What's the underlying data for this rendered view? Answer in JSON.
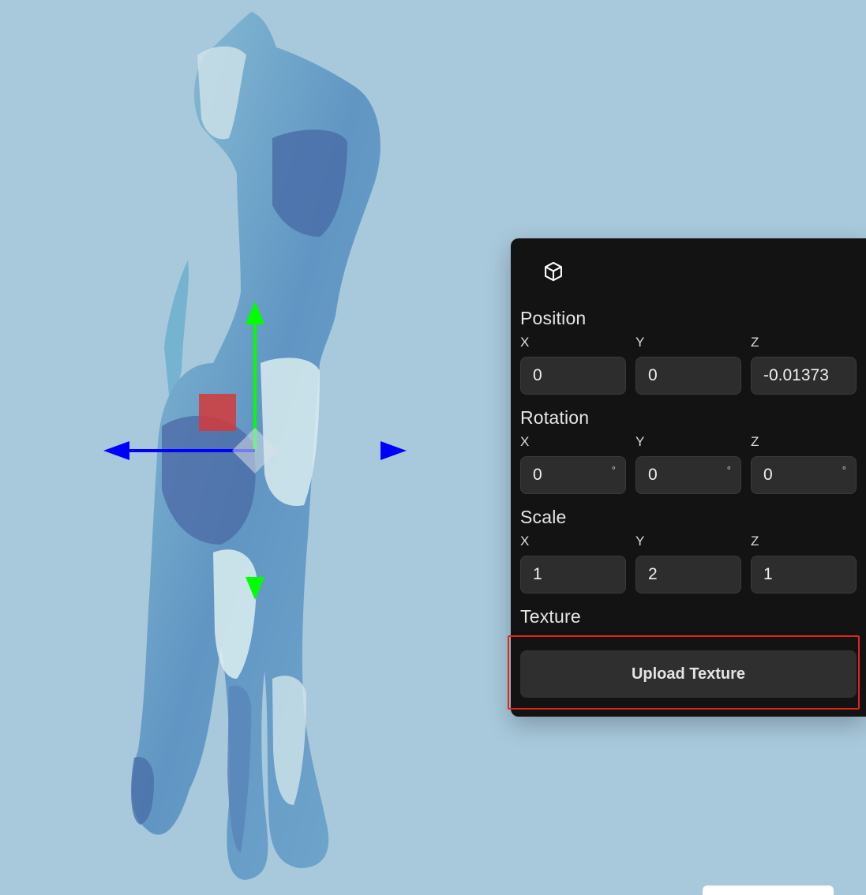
{
  "panel": {
    "icon": "cube-icon",
    "position": {
      "title": "Position",
      "x_label": "X",
      "y_label": "Y",
      "z_label": "Z",
      "x": "0",
      "y": "0",
      "z": "-0.01373"
    },
    "rotation": {
      "title": "Rotation",
      "x_label": "X",
      "y_label": "Y",
      "z_label": "Z",
      "x": "0",
      "y": "0",
      "z": "0",
      "unit": "°"
    },
    "scale": {
      "title": "Scale",
      "x_label": "X",
      "y_label": "Y",
      "z_label": "Z",
      "x": "1",
      "y": "2",
      "z": "1"
    },
    "texture": {
      "title": "Texture",
      "upload_label": "Upload Texture"
    }
  },
  "gizmo": {
    "x_axis_color": "#0000ff",
    "y_axis_color": "#00ff00",
    "plane_handle_color": "#d43a3a"
  },
  "colors": {
    "background": "#a8c9dc",
    "panel": "#131313",
    "field": "#2d2d2d",
    "highlight": "#e5231b"
  }
}
